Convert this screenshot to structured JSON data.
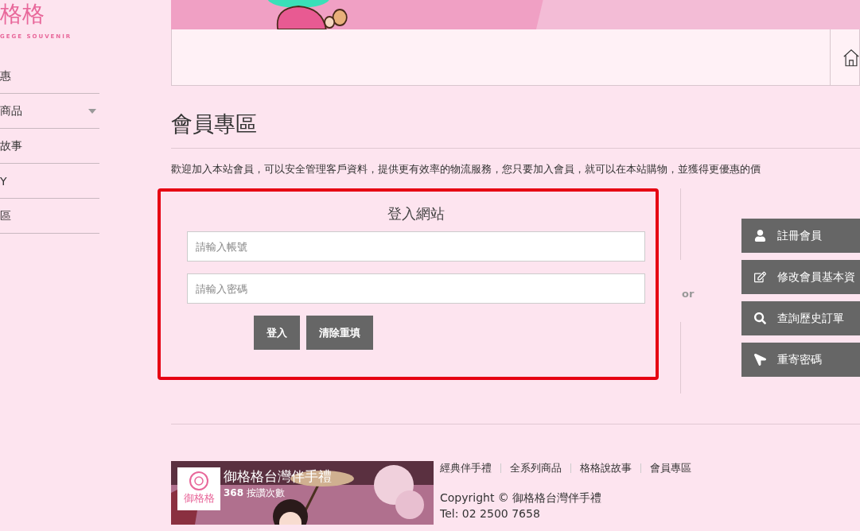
{
  "logo": {
    "name": "格格",
    "tagline": "GEGE SOUVENIR"
  },
  "sidebar": {
    "items": [
      {
        "label": "惠",
        "has_submenu": false
      },
      {
        "label": "商品",
        "has_submenu": true
      },
      {
        "label": "故事",
        "has_submenu": false
      },
      {
        "label": "Y",
        "has_submenu": false
      },
      {
        "label": "區",
        "has_submenu": false
      }
    ]
  },
  "page_title": "會員專區",
  "intro": "歡迎加入本站會員，可以安全管理客戶資料，提供更有效率的物流服務，您只要加入會員，就可以在本站購物，並獲得更優惠的價",
  "login": {
    "title": "登入網站",
    "fields": [
      {
        "placeholder": "請輸入帳號"
      },
      {
        "placeholder": "請輸入密碼"
      }
    ],
    "buttons": [
      "登入",
      "清除重填"
    ]
  },
  "divider_text": "or",
  "member_actions": [
    {
      "kind": "user",
      "label": "註冊會員"
    },
    {
      "kind": "edit",
      "label": "修改會員基本資"
    },
    {
      "kind": "search",
      "label": "查詢歷史訂單"
    },
    {
      "kind": "send",
      "label": "重寄密碼"
    }
  ],
  "footer": {
    "widget": {
      "logo_text": "御格格",
      "title": "御格格台灣伴手禮",
      "count": "368",
      "count_label": "按讚次數"
    },
    "links": [
      "經典伴手禮",
      "全系列商品",
      "格格說故事",
      "會員專區"
    ],
    "copyright": "Copyright © 御格格台灣伴手禮",
    "tel": "Tel: 02 2500 7658"
  }
}
